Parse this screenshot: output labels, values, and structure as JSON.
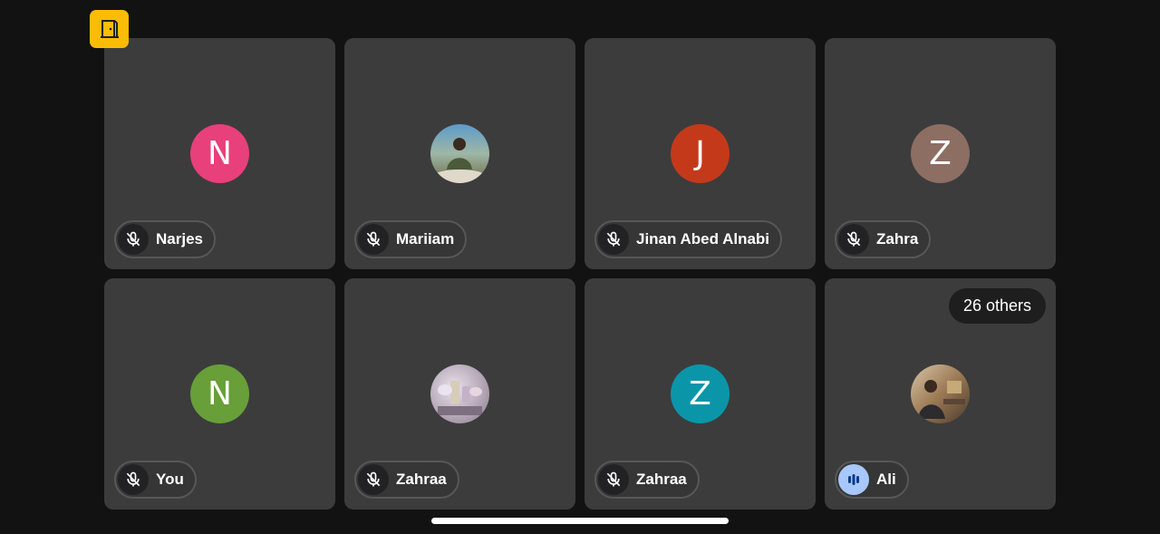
{
  "meeting": {
    "exit_icon": "door-icon",
    "others_label": "26 others"
  },
  "participants": [
    {
      "name": "Narjes",
      "initial": "N",
      "avatar_color": "#e8407a",
      "mic": "muted"
    },
    {
      "name": "Mariiam",
      "initial": "",
      "avatar_color": "#6e8a9a",
      "mic": "muted",
      "photo": true
    },
    {
      "name": "Jinan Abed Alnabi",
      "initial": "J",
      "avatar_color": "#c5391b",
      "mic": "muted"
    },
    {
      "name": "Zahra",
      "initial": "Z",
      "avatar_color": "#8d6e63",
      "mic": "muted"
    },
    {
      "name": "You",
      "initial": "N",
      "avatar_color": "#689f38",
      "mic": "muted"
    },
    {
      "name": "Zahraa",
      "initial": "",
      "avatar_color": "#b7a9b8",
      "mic": "muted",
      "photo": true
    },
    {
      "name": "Zahraa",
      "initial": "Z",
      "avatar_color": "#0a96a8",
      "mic": "muted"
    },
    {
      "name": "Ali",
      "initial": "",
      "avatar_color": "#7a6048",
      "mic": "speaking",
      "photo": true
    }
  ]
}
